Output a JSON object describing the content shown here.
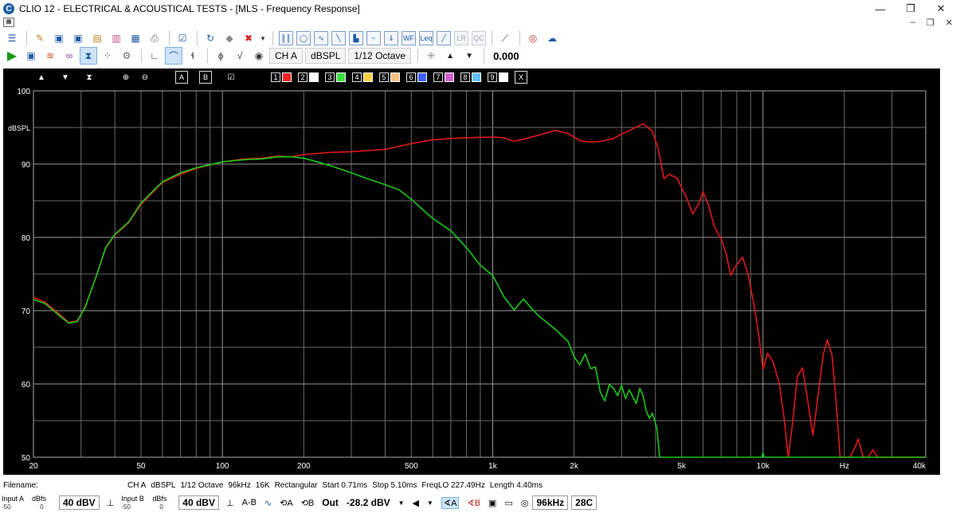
{
  "window": {
    "title": "CLIO 12 - ELECTRICAL & ACOUSTICAL TESTS - [MLS - Frequency Response]",
    "app_icon_letter": "C",
    "minimize": "—",
    "maximize": "❐",
    "close": "✕",
    "mdi_minimize": "–",
    "mdi_restore": "❐",
    "mdi_close": "✕"
  },
  "toolbar2": {
    "channel": "CH A",
    "unit": "dBSPL",
    "smoothing": "1/12 Octave",
    "value": "0.000"
  },
  "graph_toolbar": {
    "text_a": "A",
    "text_b": "B",
    "traces": [
      {
        "num": "1",
        "color": "#ff2020"
      },
      {
        "num": "2",
        "color": "#ffffff"
      },
      {
        "num": "3",
        "color": "#40e040"
      },
      {
        "num": "4",
        "color": "#ffd040"
      },
      {
        "num": "5",
        "color": "#ffc080"
      },
      {
        "num": "6",
        "color": "#4060ff"
      },
      {
        "num": "7",
        "color": "#d060d0"
      },
      {
        "num": "8",
        "color": "#60c0ff"
      },
      {
        "num": "9",
        "color": "#ffffff"
      }
    ],
    "close": "X"
  },
  "chart_data": {
    "type": "line",
    "title": "",
    "xlabel": "",
    "ylabel": "dBSPL",
    "x_scale": "log",
    "xlim": [
      20,
      40000
    ],
    "ylim": [
      50,
      100
    ],
    "grid": true,
    "y_ticks": [
      "100",
      "90",
      "80",
      "70",
      "60",
      "50"
    ],
    "x_tick_labels": [
      {
        "f": 20,
        "label": "20"
      },
      {
        "f": 50,
        "label": "50"
      },
      {
        "f": 100,
        "label": "100"
      },
      {
        "f": 200,
        "label": "200"
      },
      {
        "f": 500,
        "label": "500"
      },
      {
        "f": 1000,
        "label": "1k"
      },
      {
        "f": 2000,
        "label": "2k"
      },
      {
        "f": 5000,
        "label": "5k"
      },
      {
        "f": 10000,
        "label": "10k"
      },
      {
        "f": 20000,
        "label": "Hz"
      },
      {
        "f": 40000,
        "label": "40k"
      }
    ],
    "series": [
      {
        "color": "#e01818",
        "points": [
          [
            20,
            71.8
          ],
          [
            22,
            71.2
          ],
          [
            25,
            69.5
          ],
          [
            27,
            68.4
          ],
          [
            29,
            68.6
          ],
          [
            31,
            70.5
          ],
          [
            34,
            74.5
          ],
          [
            37,
            78.5
          ],
          [
            40,
            80.3
          ],
          [
            45,
            82.0
          ],
          [
            50,
            84.5
          ],
          [
            60,
            87.5
          ],
          [
            70,
            88.6
          ],
          [
            80,
            89.4
          ],
          [
            100,
            90.3
          ],
          [
            120,
            90.7
          ],
          [
            140,
            90.8
          ],
          [
            160,
            91.1
          ],
          [
            180,
            91.0
          ],
          [
            200,
            91.3
          ],
          [
            250,
            91.6
          ],
          [
            300,
            91.7
          ],
          [
            400,
            92.0
          ],
          [
            500,
            92.8
          ],
          [
            600,
            93.3
          ],
          [
            700,
            93.5
          ],
          [
            800,
            93.6
          ],
          [
            1000,
            93.7
          ],
          [
            1100,
            93.6
          ],
          [
            1200,
            93.1
          ],
          [
            1300,
            93.4
          ],
          [
            1500,
            94.0
          ],
          [
            1700,
            94.6
          ],
          [
            1900,
            94.2
          ],
          [
            2100,
            93.2
          ],
          [
            2300,
            93.0
          ],
          [
            2500,
            93.1
          ],
          [
            2800,
            93.5
          ],
          [
            3000,
            94.1
          ],
          [
            3300,
            94.8
          ],
          [
            3600,
            95.5
          ],
          [
            3900,
            94.5
          ],
          [
            4100,
            92.0
          ],
          [
            4300,
            88.0
          ],
          [
            4500,
            88.6
          ],
          [
            4800,
            88.1
          ],
          [
            5200,
            85.5
          ],
          [
            5500,
            83.2
          ],
          [
            5800,
            84.7
          ],
          [
            6000,
            86.2
          ],
          [
            6300,
            84.3
          ],
          [
            6600,
            81.5
          ],
          [
            7000,
            79.8
          ],
          [
            7300,
            77.8
          ],
          [
            7600,
            74.8
          ],
          [
            7900,
            76.0
          ],
          [
            8400,
            77.3
          ],
          [
            8800,
            75.0
          ],
          [
            9300,
            70.5
          ],
          [
            9700,
            66.0
          ],
          [
            10000,
            62.0
          ],
          [
            10400,
            64.2
          ],
          [
            10900,
            63.0
          ],
          [
            11500,
            60.0
          ],
          [
            12000,
            55.0
          ],
          [
            12400,
            50.0
          ],
          [
            12800,
            54.0
          ],
          [
            13400,
            61.0
          ],
          [
            14000,
            62.2
          ],
          [
            14600,
            58.0
          ],
          [
            15300,
            53.0
          ],
          [
            16000,
            58.5
          ],
          [
            16700,
            64.0
          ],
          [
            17300,
            66.0
          ],
          [
            18000,
            64.0
          ],
          [
            18600,
            58.0
          ],
          [
            19300,
            50.0
          ],
          [
            21000,
            50.0
          ],
          [
            22000,
            51.5
          ],
          [
            22500,
            52.5
          ],
          [
            23500,
            50.0
          ],
          [
            24500,
            50.0
          ],
          [
            25500,
            51.0
          ],
          [
            26500,
            50.0
          ],
          [
            40000,
            50.0
          ]
        ]
      },
      {
        "color": "#18c818",
        "points": [
          [
            20,
            71.5
          ],
          [
            22,
            71.0
          ],
          [
            25,
            69.3
          ],
          [
            27,
            68.3
          ],
          [
            29,
            68.5
          ],
          [
            31,
            70.4
          ],
          [
            34,
            74.5
          ],
          [
            37,
            78.6
          ],
          [
            40,
            80.4
          ],
          [
            45,
            82.1
          ],
          [
            50,
            84.7
          ],
          [
            60,
            87.6
          ],
          [
            70,
            88.8
          ],
          [
            80,
            89.5
          ],
          [
            100,
            90.3
          ],
          [
            120,
            90.6
          ],
          [
            140,
            90.7
          ],
          [
            160,
            91.0
          ],
          [
            180,
            91.0
          ],
          [
            200,
            90.8
          ],
          [
            220,
            90.4
          ],
          [
            250,
            89.8
          ],
          [
            300,
            88.8
          ],
          [
            350,
            87.9
          ],
          [
            400,
            87.2
          ],
          [
            450,
            86.5
          ],
          [
            500,
            85.2
          ],
          [
            550,
            83.8
          ],
          [
            600,
            82.6
          ],
          [
            700,
            80.9
          ],
          [
            800,
            78.6
          ],
          [
            900,
            76.2
          ],
          [
            1000,
            74.8
          ],
          [
            1100,
            71.9
          ],
          [
            1200,
            70.1
          ],
          [
            1300,
            71.6
          ],
          [
            1400,
            70.2
          ],
          [
            1500,
            69.1
          ],
          [
            1700,
            67.5
          ],
          [
            1900,
            65.8
          ],
          [
            2000,
            63.7
          ],
          [
            2100,
            62.6
          ],
          [
            2200,
            64.1
          ],
          [
            2300,
            62.1
          ],
          [
            2400,
            62.3
          ],
          [
            2500,
            58.9
          ],
          [
            2600,
            57.7
          ],
          [
            2700,
            59.9
          ],
          [
            2800,
            59.4
          ],
          [
            2900,
            58.4
          ],
          [
            3000,
            59.8
          ],
          [
            3100,
            58.0
          ],
          [
            3200,
            59.2
          ],
          [
            3400,
            57.3
          ],
          [
            3500,
            59.4
          ],
          [
            3600,
            58.4
          ],
          [
            3700,
            56.3
          ],
          [
            3800,
            55.3
          ],
          [
            3900,
            56.0
          ],
          [
            4050,
            54.0
          ],
          [
            4150,
            50.0
          ],
          [
            5000,
            50.0
          ],
          [
            9900,
            50.0
          ],
          [
            10000,
            50.6
          ],
          [
            10100,
            50.0
          ],
          [
            40000,
            50.0
          ]
        ]
      }
    ]
  },
  "status": {
    "filename_label": "Filename:",
    "info": [
      "CH A",
      "dBSPL",
      "1/12 Octave",
      "96kHz",
      "16K",
      "Rectangular",
      "Start 0.71ms",
      "Stop 5.10ms",
      "FreqLO 227.49Hz",
      "Length 4.40ms"
    ],
    "input_a_label": "Input A",
    "input_b_label": "Input B",
    "dbfs": "dBfs",
    "scale_min": "-50",
    "scale_max": "0",
    "input_a_value": "40 dBV",
    "input_b_value": "40 dBV",
    "a_b": "A-B",
    "out_label": "Out",
    "out_value": "-28.2 dBV",
    "samplerate": "96kHz",
    "temperature": "28C"
  }
}
